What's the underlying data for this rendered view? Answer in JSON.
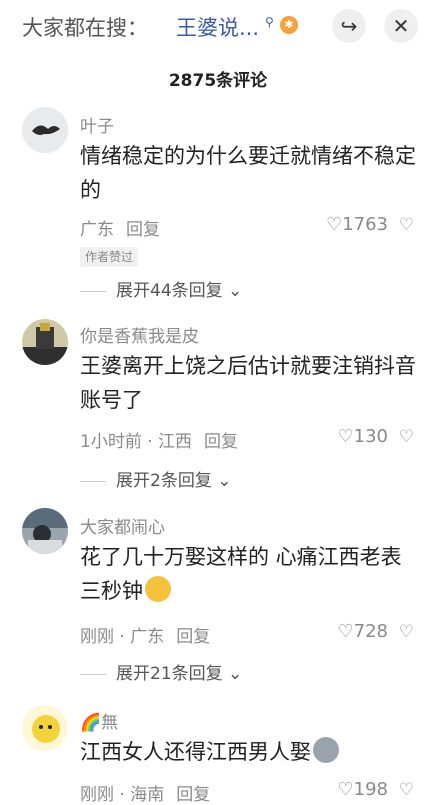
{
  "header": {
    "search_prefix": "大家都在搜：",
    "search_term": "王婆说...",
    "search_icon": "search-icon",
    "hot_badge": "hot-icon",
    "collapse_icon": "collapse-icon",
    "close_icon": "close-icon"
  },
  "comment_count": "2875条评论",
  "comments": [
    {
      "username": "叶子",
      "text": "情绪稳定的为什么要迁就情绪不稳定的",
      "meta": "广东",
      "reply_label": "回复",
      "likes": "1763",
      "tag": "作者赞过",
      "expand": "展开44条回复"
    },
    {
      "username": "你是香蕉我是皮",
      "text": "王婆离开上饶之后估计就要注销抖音账号了",
      "meta": "1小时前 · 江西",
      "reply_label": "回复",
      "likes": "130",
      "expand": "展开2条回复"
    },
    {
      "username": "大家都闹心",
      "text": "花了几十万娶这样的 心痛江西老表三秒钟",
      "meta": "刚刚 · 广东",
      "reply_label": "回复",
      "likes": "728",
      "expand": "展开21条回复"
    },
    {
      "username": "無",
      "text": "江西女人还得江西男人娶",
      "meta": "刚刚 · 海南",
      "reply_label": "回复",
      "likes": "198"
    }
  ],
  "colors": {
    "accent_link": "#3b5ba8",
    "muted": "#8a8a8a",
    "badge_orange": "#f6a23c"
  }
}
